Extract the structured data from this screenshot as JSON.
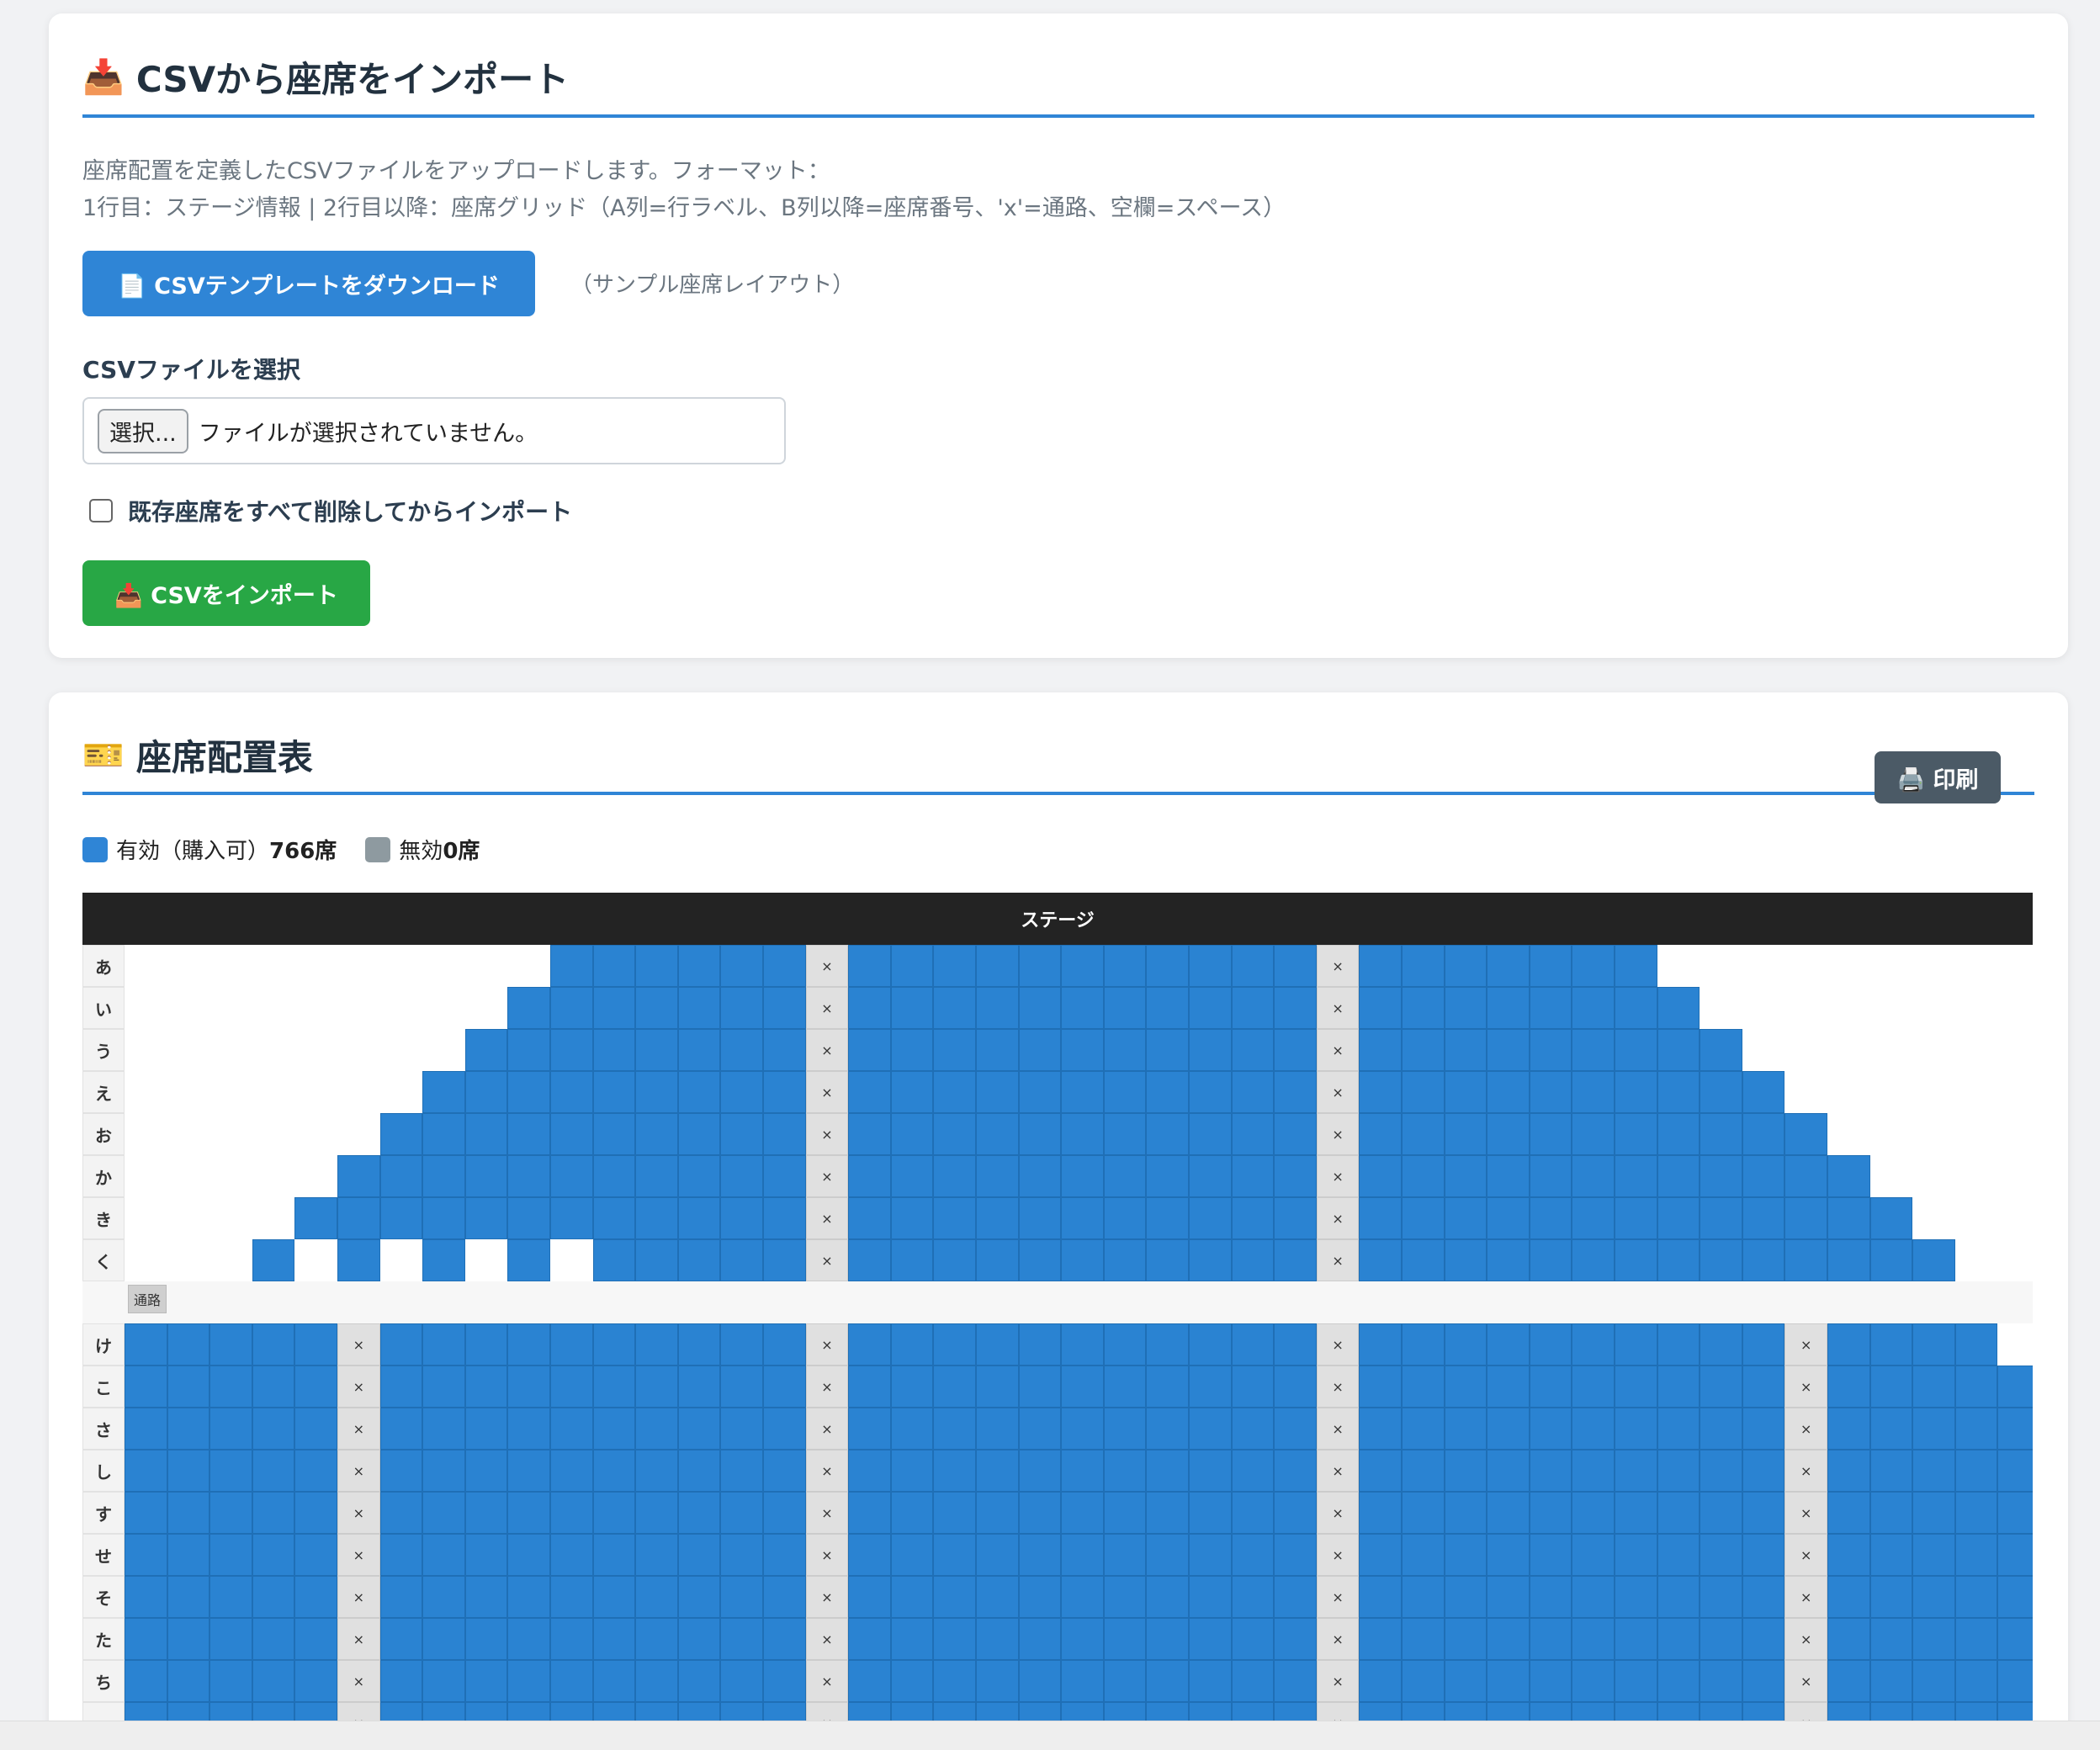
{
  "import_section": {
    "icon": "📥",
    "title": "CSVから座席をインポート",
    "description_line1": "座席配置を定義したCSVファイルをアップロードします。フォーマット：",
    "description_line2": "1行目：ステージ情報 | 2行目以降：座席グリッド（A列=行ラベル、B列以降=座席番号、'x'=通路、空欄=スペース）",
    "template_button": "📄 CSVテンプレートをダウンロード",
    "template_note": "（サンプル座席レイアウト）",
    "file_label": "CSVファイルを選択",
    "file_button": "選択...",
    "file_status": "ファイルが選択されていません。",
    "delete_existing_label": "既存座席をすべて削除してからインポート",
    "delete_existing_checked": false,
    "import_button": "📥 CSVをインポート"
  },
  "seatmap_section": {
    "icon": "🎫",
    "title": "座席配置表",
    "print_button": "🖨️ 印刷",
    "legend": {
      "valid_label": "有効（購入可）",
      "valid_count": "766席",
      "invalid_label": "無効",
      "invalid_count": "0席",
      "valid_color": "#2a83d2",
      "invalid_color": "#8e9aa0"
    },
    "stage_label": "ステージ",
    "aisle_row_label": "通路",
    "aisle_symbol": "×",
    "rows_front": [
      {
        "label": "あ",
        "start": 10,
        "end": 35
      },
      {
        "label": "い",
        "start": 9,
        "end": 36
      },
      {
        "label": "う",
        "start": 8,
        "end": 37
      },
      {
        "label": "え",
        "start": 7,
        "end": 38
      },
      {
        "label": "お",
        "start": 6,
        "end": 39
      },
      {
        "label": "か",
        "start": 5,
        "end": 40
      },
      {
        "label": "き",
        "start": 4,
        "end": 41
      },
      {
        "label": "く",
        "start": 3,
        "end": 42,
        "gaps": [
          4,
          6,
          8,
          10
        ]
      }
    ],
    "rows_back": [
      {
        "label": "け",
        "end": 43
      },
      {
        "label": "こ",
        "end": 44
      },
      {
        "label": "さ",
        "end": 45
      },
      {
        "label": "し",
        "end": 45
      },
      {
        "label": "す",
        "end": 45
      },
      {
        "label": "せ",
        "end": 45
      },
      {
        "label": "そ",
        "end": 45
      },
      {
        "label": "た",
        "end": 45
      },
      {
        "label": "ち",
        "end": 45
      },
      {
        "label": "",
        "end": 45
      }
    ],
    "front_aisle_columns": [
      16,
      28
    ],
    "back_aisle_columns": [
      5,
      16,
      28,
      39
    ]
  }
}
